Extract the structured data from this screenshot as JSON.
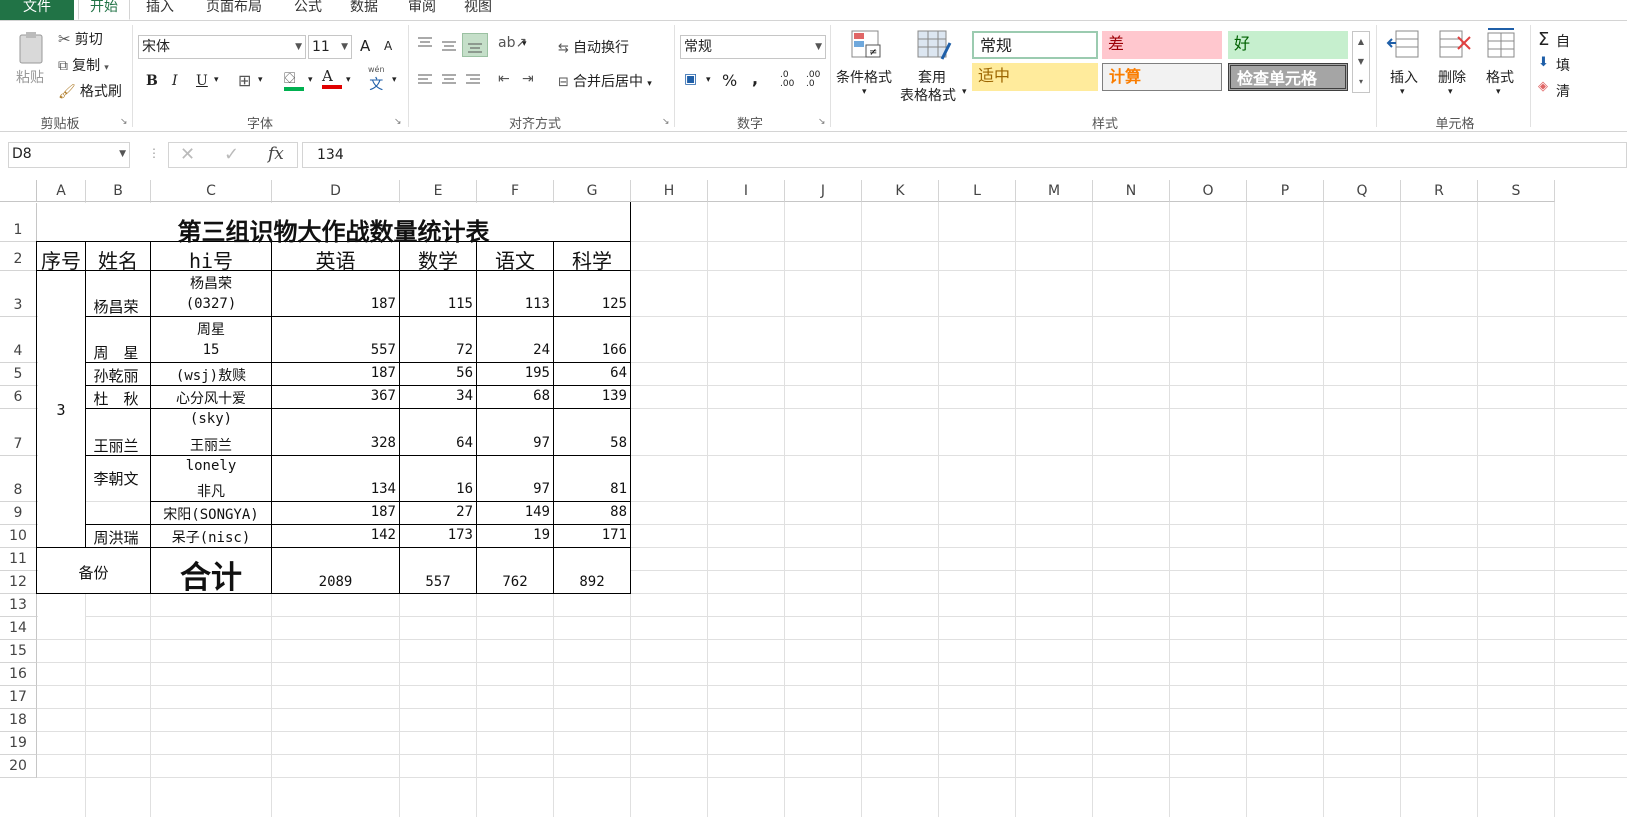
{
  "tabs": [
    "文件",
    "开始",
    "插入",
    "页面布局",
    "公式",
    "数据",
    "审阅",
    "视图"
  ],
  "ribbon": {
    "clipboard": {
      "paste": "粘贴",
      "cut": "剪切",
      "copy": "复制",
      "format_painter": "格式刷",
      "label": "剪贴板"
    },
    "font": {
      "name": "宋体",
      "size": "11",
      "grow": "A",
      "shrink": "A",
      "bold": "B",
      "italic": "I",
      "underline": "U",
      "fill": "A",
      "color": "A",
      "phonetic_top": "wén",
      "phonetic": "文",
      "label": "字体"
    },
    "alignment": {
      "wrap": "自动换行",
      "merge": "合并后居中",
      "label": "对齐方式"
    },
    "number": {
      "format": "常规",
      "percent": "%",
      "comma": ",",
      "inc": ".00",
      "dec": ".0",
      "label": "数字"
    },
    "styles": {
      "conditional": "条件格式",
      "table_line1": "套用",
      "table_line2": "表格格式",
      "items": [
        "常规",
        "差",
        "好",
        "适中",
        "计算",
        "检查单元格"
      ],
      "label": "样式"
    },
    "cells": {
      "insert": "插入",
      "delete": "删除",
      "format": "格式",
      "label": "单元格"
    },
    "editing": {
      "sum": "Σ",
      "fill": "填",
      "clear": "清",
      "autosum": "自"
    }
  },
  "formula_bar": {
    "name_box": "D8",
    "fx": "fx",
    "value": "134"
  },
  "columns": [
    "A",
    "B",
    "C",
    "D",
    "E",
    "F",
    "G",
    "H",
    "I",
    "J",
    "K",
    "L",
    "M",
    "N",
    "O",
    "P",
    "Q",
    "R",
    "S"
  ],
  "rows": [
    "1",
    "2",
    "3",
    "4",
    "5",
    "6",
    "7",
    "8",
    "9",
    "10",
    "11",
    "12",
    "13",
    "14",
    "15",
    "16",
    "17",
    "18",
    "19",
    "20"
  ],
  "sheet": {
    "title": "第三组识物大作战数量统计表",
    "headers": [
      "序号",
      "姓名",
      "hi号",
      "英语",
      "数学",
      "语文",
      "科学"
    ],
    "group_no": "3",
    "records": [
      {
        "name": "杨昌荣",
        "hi1": "杨昌荣",
        "hi2": "(0327)",
        "en": "187",
        "math": "115",
        "cn": "113",
        "sci": "125"
      },
      {
        "name": "周　星",
        "hi1": "周星",
        "hi2": "15",
        "en": "557",
        "math": "72",
        "cn": "24",
        "sci": "166"
      },
      {
        "name": "孙乾丽",
        "hi1": "(wsj)敖赎",
        "en": "187",
        "math": "56",
        "cn": "195",
        "sci": "64"
      },
      {
        "name": "杜　秋",
        "hi1": "心分风十爱",
        "en": "367",
        "math": "34",
        "cn": "68",
        "sci": "139"
      },
      {
        "name": "王丽兰",
        "hi1": "(sky)",
        "hi2": "王丽兰",
        "en": "328",
        "math": "64",
        "cn": "97",
        "sci": "58"
      },
      {
        "name": "李朝文",
        "hi1": "lonely",
        "hi2": "非凡",
        "en": "134",
        "math": "16",
        "cn": "97",
        "sci": "81"
      },
      {
        "hi1": "宋阳(SONGYA)",
        "en": "187",
        "math": "27",
        "cn": "149",
        "sci": "88"
      },
      {
        "name": "周洪瑞",
        "hi1": "呆子(nisc)",
        "en": "142",
        "math": "173",
        "cn": "19",
        "sci": "171"
      }
    ],
    "footer": {
      "remark": "备份",
      "total_label": "合计",
      "en": "2089",
      "math": "557",
      "cn": "762",
      "sci": "892"
    }
  }
}
